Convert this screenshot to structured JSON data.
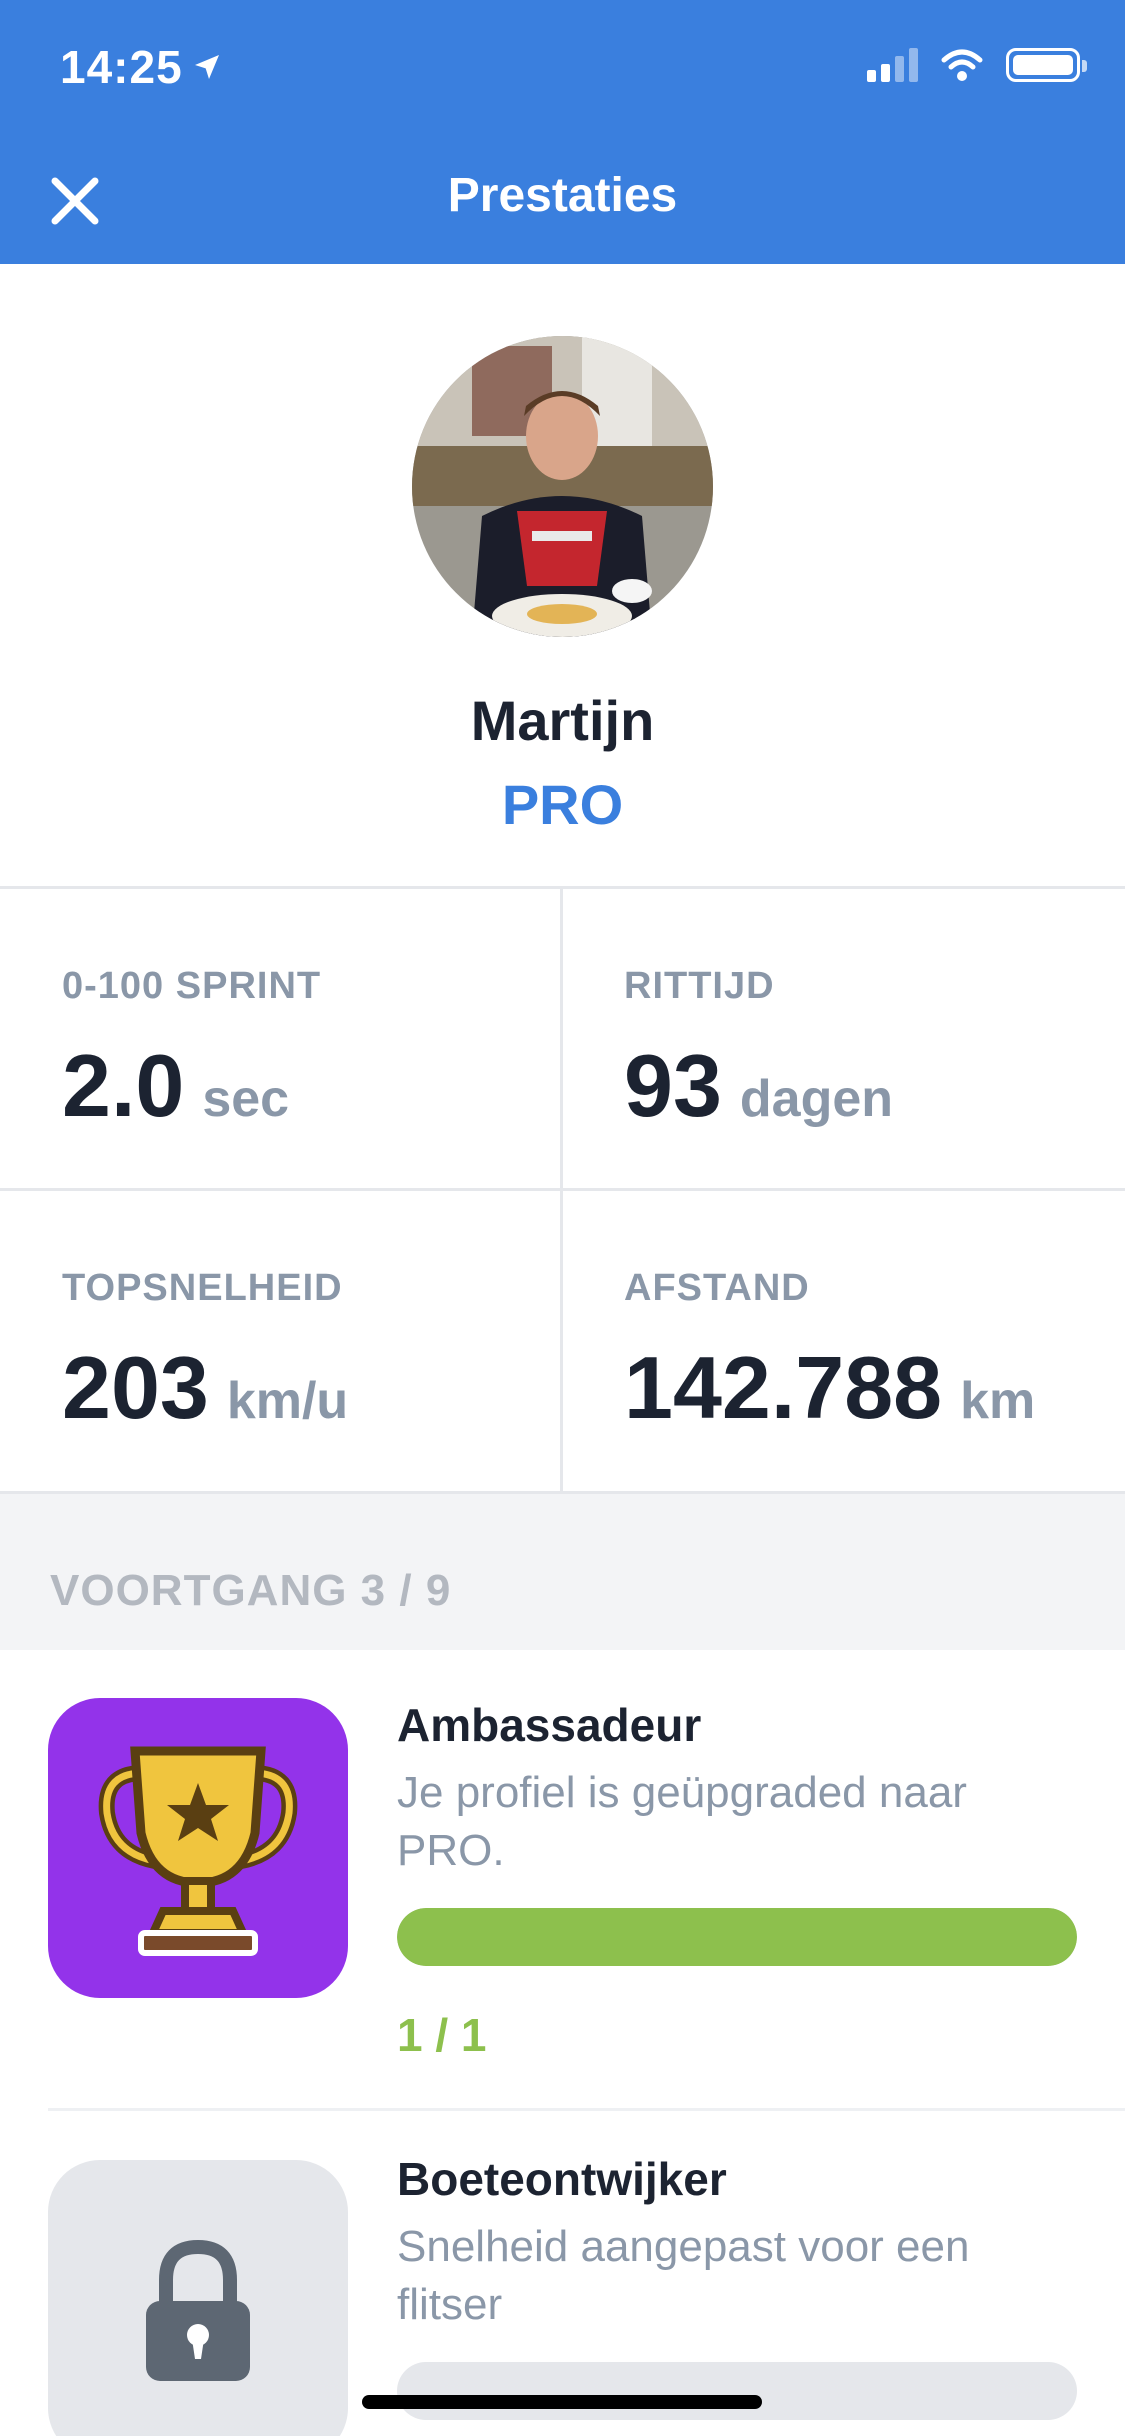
{
  "status_bar": {
    "time": "14:25"
  },
  "header": {
    "title": "Prestaties"
  },
  "profile": {
    "name": "Martijn",
    "plan": "PRO"
  },
  "stats": [
    {
      "label": "0-100 SPRINT",
      "value": "2.0",
      "unit": "sec"
    },
    {
      "label": "RITTIJD",
      "value": "93",
      "unit": "dagen"
    },
    {
      "label": "TOPSNELHEID",
      "value": "203",
      "unit": "km/u"
    },
    {
      "label": "AFSTAND",
      "value": "142.788",
      "unit": "km"
    }
  ],
  "progress_section": {
    "title": "VOORTGANG 3 / 9"
  },
  "achievements": [
    {
      "title": "Ambassadeur",
      "description": "Je profiel is geüpgraded naar PRO.",
      "progress": 1.0,
      "count": "1 / 1",
      "icon": "trophy-icon",
      "tile_color": "#9333ea"
    },
    {
      "title": "Boeteontwijker",
      "description": "Snelheid aangepast voor een flitser",
      "progress": 0.0,
      "icon": "lock-icon",
      "tile_color": "#e5e7eb"
    }
  ],
  "colors": {
    "accent": "#3a7fde",
    "progress": "#8dc04d",
    "muted": "#8a97a8"
  }
}
